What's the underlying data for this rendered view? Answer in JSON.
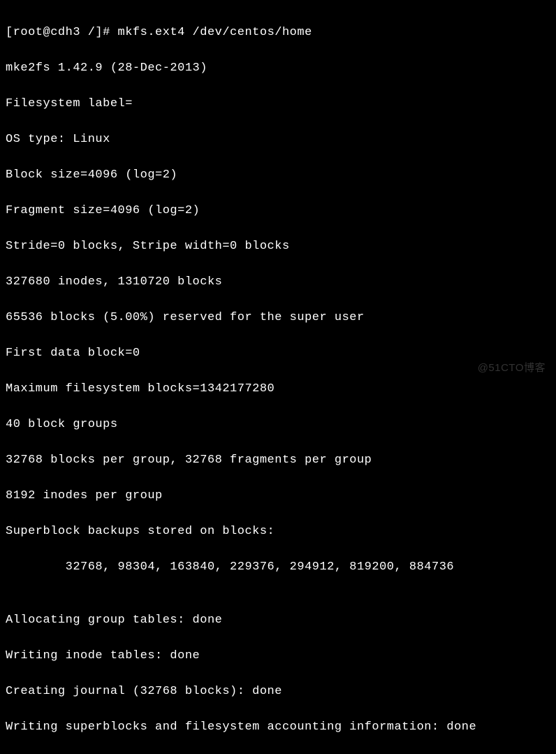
{
  "terminal": {
    "prompt": "[root@cdh3 /]# ",
    "command": "mkfs.ext4 /dev/centos/home",
    "lines": [
      "mke2fs 1.42.9 (28-Dec-2013)",
      "Filesystem label=",
      "OS type: Linux",
      "Block size=4096 (log=2)",
      "Fragment size=4096 (log=2)",
      "Stride=0 blocks, Stripe width=0 blocks",
      "327680 inodes, 1310720 blocks",
      "65536 blocks (5.00%) reserved for the super user",
      "First data block=0",
      "Maximum filesystem blocks=1342177280",
      "40 block groups",
      "32768 blocks per group, 32768 fragments per group",
      "8192 inodes per group",
      "Superblock backups stored on blocks: ",
      "        32768, 98304, 163840, 229376, 294912, 819200, 884736",
      "",
      "Allocating group tables: done",
      "Writing inode tables: done",
      "Creating journal (32768 blocks): done",
      "Writing superblocks and filesystem accounting information: done"
    ]
  },
  "watermark": "@51CTO博客"
}
